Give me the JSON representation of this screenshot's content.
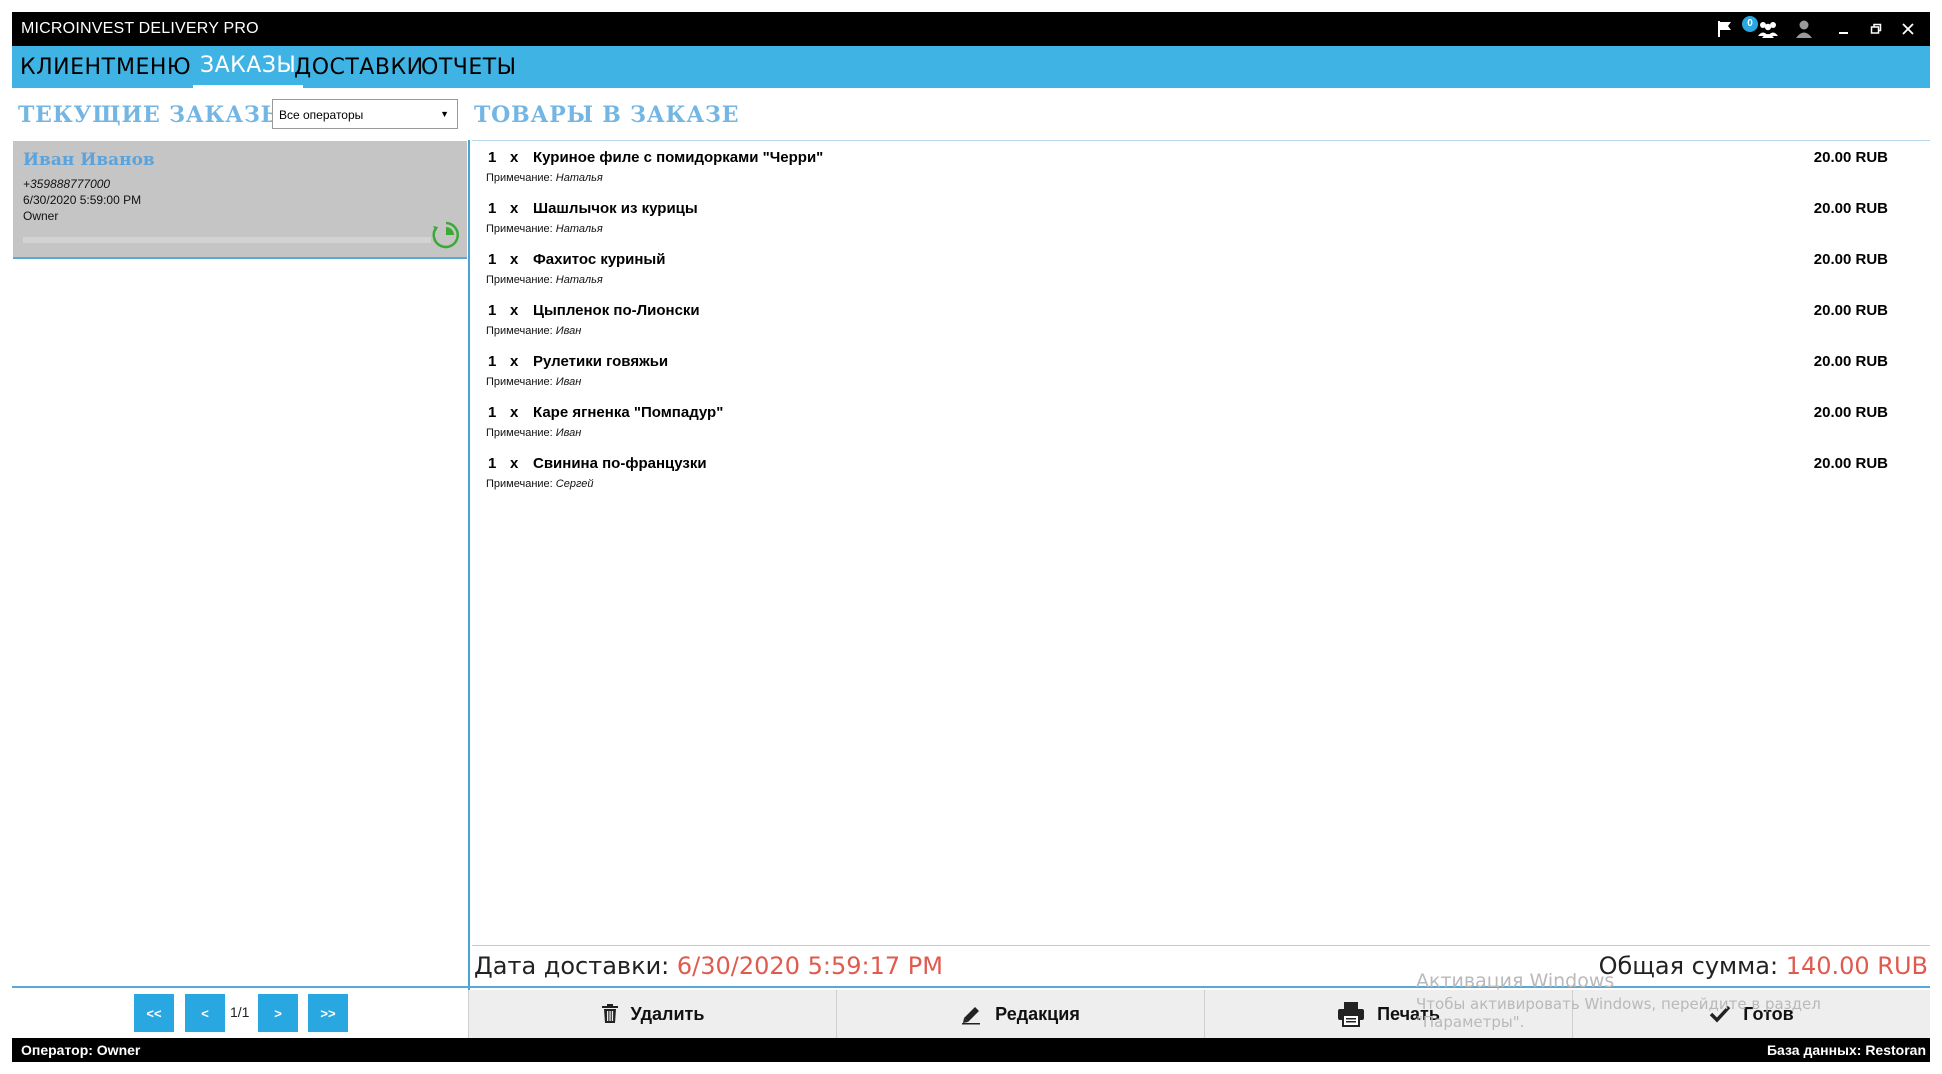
{
  "window": {
    "title": "MICROINVEST DELIVERY PRO",
    "notification_count": "0",
    "icons": [
      "flag-icon",
      "users-icon",
      "user-icon",
      "minimize-icon",
      "restore-icon",
      "close-icon"
    ]
  },
  "menu": {
    "items": [
      {
        "label": "КЛИЕНТ"
      },
      {
        "label": "МЕНЮ"
      },
      {
        "label": "ЗАКАЗЫ",
        "active": true
      },
      {
        "label": "ДОСТАВКИ"
      },
      {
        "label": "ОТЧЕТЫ"
      }
    ]
  },
  "left": {
    "title": "ТЕКУЩИЕ ЗАКАЗЫ",
    "operator_filter": "Все операторы",
    "orders": [
      {
        "name": "Иван Иванов",
        "phone": "+359888777000",
        "datetime": "6/30/2020 5:59:00 PM",
        "operator": "Owner"
      }
    ],
    "pager": {
      "first": "<<",
      "prev": "<",
      "info": "1/1",
      "next": ">",
      "last": ">>"
    }
  },
  "right": {
    "title": "ТОВАРЫ В ЗАКАЗЕ",
    "note_label": "Примечание:",
    "items": [
      {
        "qty": "1",
        "x": "x",
        "name": "Куриное филе с помидорками \"Черри\"",
        "price": "20.00 RUB",
        "note": "Наталья"
      },
      {
        "qty": "1",
        "x": "x",
        "name": "Шашлычок из курицы",
        "price": "20.00 RUB",
        "note": "Наталья"
      },
      {
        "qty": "1",
        "x": "x",
        "name": "Фахитос куриный",
        "price": "20.00 RUB",
        "note": "Наталья"
      },
      {
        "qty": "1",
        "x": "x",
        "name": "Цыпленок по-Лионски",
        "price": "20.00 RUB",
        "note": "Иван"
      },
      {
        "qty": "1",
        "x": "x",
        "name": "Рулетики говяжьи",
        "price": "20.00 RUB",
        "note": "Иван"
      },
      {
        "qty": "1",
        "x": "x",
        "name": "Каре ягненка \"Помпадур\"",
        "price": "20.00 RUB",
        "note": "Иван"
      },
      {
        "qty": "1",
        "x": "x",
        "name": "Свинина по-французки",
        "price": "20.00 RUB",
        "note": "Сергей"
      }
    ],
    "delivery_label": "Дата доставки:",
    "delivery_value": "6/30/2020 5:59:17 PM",
    "total_label": "Общая сумма:",
    "total_value": "140.00 RUB"
  },
  "actions": {
    "delete": "Удалить",
    "edit": "Редакция",
    "print": "Печать",
    "done": "Готов"
  },
  "watermark": {
    "line1": "Активация Windows",
    "line2": "Чтобы активировать Windows, перейдите в раздел \"Параметры\"."
  },
  "status": {
    "operator": "Оператор: Owner",
    "database": "База данных: Restoran"
  }
}
